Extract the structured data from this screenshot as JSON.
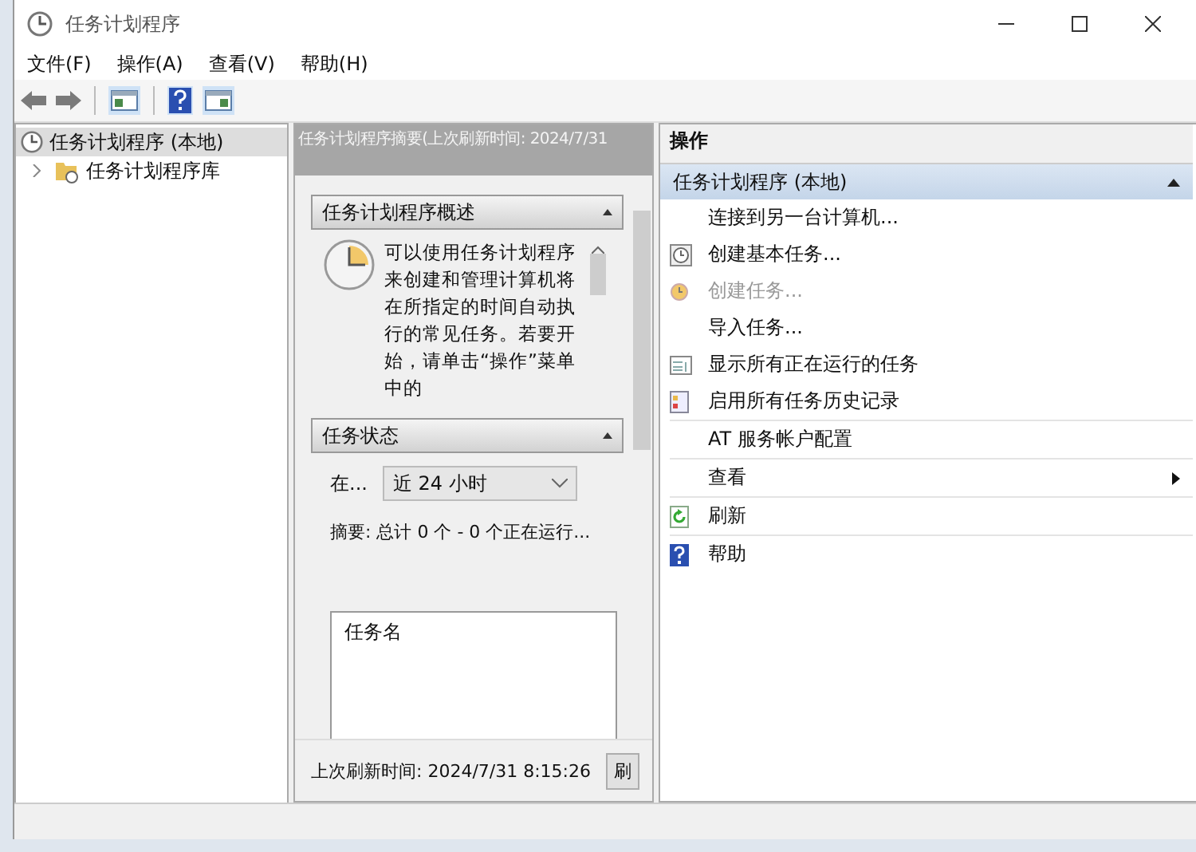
{
  "window": {
    "title": "任务计划程序"
  },
  "menu": [
    {
      "label": "文件(F)"
    },
    {
      "label": "操作(A)"
    },
    {
      "label": "查看(V)"
    },
    {
      "label": "帮助(H)"
    }
  ],
  "tree": [
    {
      "label": "任务计划程序 (本地)",
      "selected": true,
      "children": [
        {
          "label": "任务计划程序库",
          "selected": false,
          "expanded": false
        }
      ]
    }
  ],
  "summary": {
    "header": "任务计划程序摘要(上次刷新时间: 2024/7/31",
    "overview": {
      "title": "任务计划程序概述",
      "text": "可以使用任务计划程序来创建和管理计算机将在所指定的时间自动执行的常见任务。若要开始，请单击“操作”菜单中的"
    },
    "status": {
      "title": "任务状态",
      "period_label": "在...",
      "period_value": "近 24 小时",
      "summary": "摘要: 总计 0 个 - 0 个正在运行...",
      "columns": [
        "任务名"
      ]
    },
    "footer": "上次刷新时间: 2024/7/31 8:15:26",
    "refresh_button": "刷"
  },
  "actions": {
    "title": "操作",
    "group": "任务计划程序 (本地)",
    "expanded": true,
    "items": [
      {
        "label": "连接到另一台计算机...",
        "disabled": false,
        "separated": false,
        "submenu": false
      },
      {
        "label": "创建基本任务...",
        "disabled": false,
        "separated": false,
        "submenu": false
      },
      {
        "label": "创建任务...",
        "disabled": true,
        "separated": false,
        "submenu": false
      },
      {
        "label": "导入任务...",
        "disabled": false,
        "separated": false,
        "submenu": false
      },
      {
        "label": "显示所有正在运行的任务",
        "disabled": false,
        "separated": false,
        "submenu": false
      },
      {
        "label": "启用所有任务历史记录",
        "disabled": false,
        "separated": false,
        "submenu": false
      },
      {
        "label": "AT 服务帐户配置",
        "disabled": false,
        "separated": true,
        "submenu": false
      },
      {
        "label": "查看",
        "disabled": false,
        "separated": true,
        "submenu": true
      },
      {
        "label": "刷新",
        "disabled": false,
        "separated": true,
        "submenu": false
      },
      {
        "label": "帮助",
        "disabled": false,
        "separated": true,
        "submenu": false
      }
    ]
  }
}
